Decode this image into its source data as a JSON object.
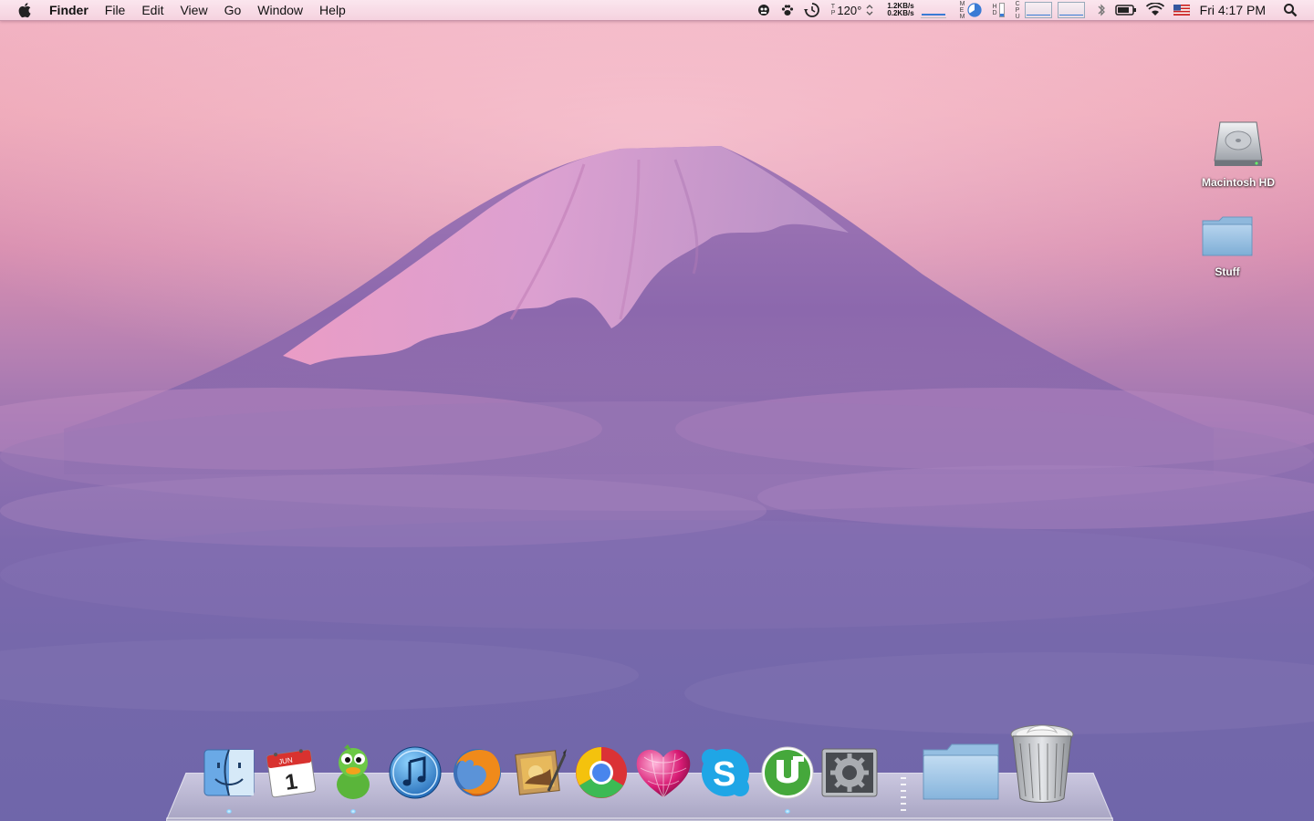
{
  "menubar": {
    "app_name": "Finder",
    "menus": [
      "File",
      "Edit",
      "View",
      "Go",
      "Window",
      "Help"
    ],
    "temperature": "120°",
    "temp_label": [
      "T",
      "P"
    ],
    "net_up": "1.2KB/s",
    "net_down": "0.2KB/s",
    "mem_label": [
      "M",
      "E",
      "M"
    ],
    "hd_label": [
      "H",
      "D"
    ],
    "cpu_label": [
      "C",
      "P",
      "U"
    ],
    "clock": "Fri 4:17 PM",
    "icons": [
      "apple-icon",
      "growl-icon",
      "paw-icon",
      "time-machine-icon",
      "temperature-icon",
      "network-monitor-icon",
      "memory-monitor-icon",
      "disk-monitor-icon",
      "cpu-monitor-icon",
      "bluetooth-icon",
      "battery-icon",
      "wifi-icon",
      "us-flag-input-icon",
      "spotlight-icon"
    ]
  },
  "desktop": {
    "items": [
      {
        "label": "Macintosh HD",
        "icon": "hard-drive-icon"
      },
      {
        "label": "Stuff",
        "icon": "folder-icon"
      }
    ]
  },
  "dock": {
    "calendar_month": "JUN",
    "calendar_day": "1",
    "items": [
      "finder-icon",
      "ical-icon",
      "adium-icon",
      "itunes-icon",
      "firefox-icon",
      "iphoto-icon",
      "chrome-icon",
      "mikogo-heart-icon",
      "skype-icon",
      "utorrent-icon",
      "system-preferences-icon",
      "separator",
      "documents-folder-icon",
      "trash-icon"
    ],
    "running": [
      "finder",
      "adium",
      "utorrent"
    ]
  },
  "colors": {
    "menubar_bg": "#f5d2df",
    "sky_top": "#f2b3c3",
    "sky_bottom": "#6f66aa",
    "mountain": "#8f68ad",
    "snow": "#e7a8cf"
  }
}
